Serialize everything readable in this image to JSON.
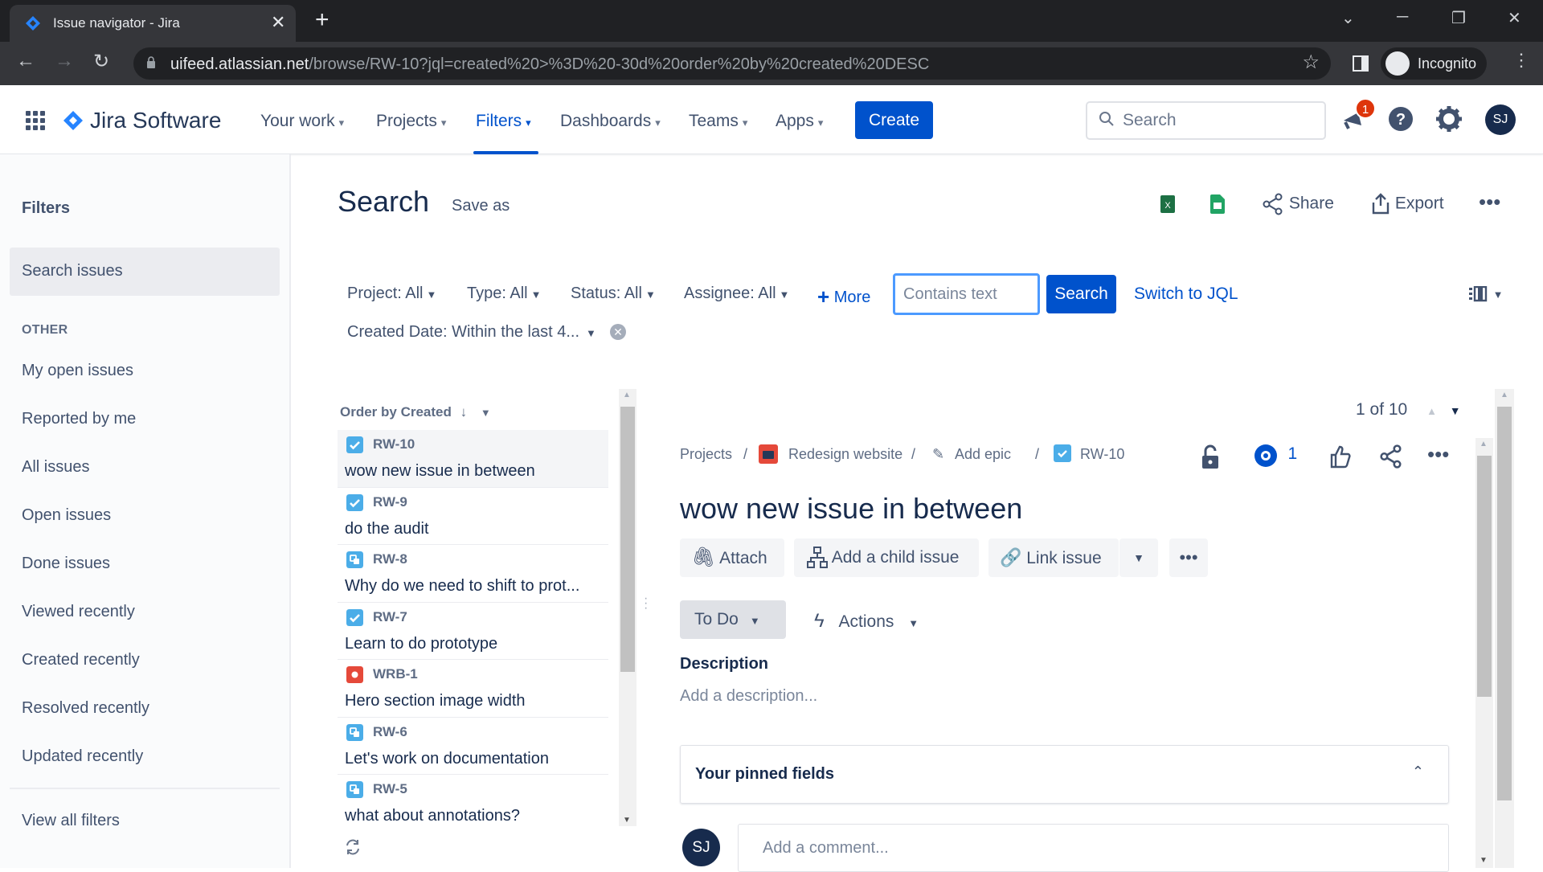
{
  "browser": {
    "tab_title": "Issue navigator - Jira",
    "url_host": "uifeed.atlassian.net",
    "url_path": "/browse/RW-10?jql=created%20>%3D%20-30d%20order%20by%20created%20DESC",
    "profile_label": "Incognito"
  },
  "header": {
    "product_name": "Jira Software",
    "nav": [
      {
        "label": "Your work"
      },
      {
        "label": "Projects"
      },
      {
        "label": "Filters"
      },
      {
        "label": "Dashboards"
      },
      {
        "label": "Teams"
      },
      {
        "label": "Apps"
      }
    ],
    "create_label": "Create",
    "search_placeholder": "Search",
    "notification_count": "1",
    "user_initials": "SJ",
    "accent": "#0052cc"
  },
  "sidebar": {
    "title": "Filters",
    "selected": "Search issues",
    "section_label": "OTHER",
    "items": [
      {
        "label": "My open issues"
      },
      {
        "label": "Reported by me"
      },
      {
        "label": "All issues"
      },
      {
        "label": "Open issues"
      },
      {
        "label": "Done issues"
      },
      {
        "label": "Viewed recently"
      },
      {
        "label": "Created recently"
      },
      {
        "label": "Resolved recently"
      },
      {
        "label": "Updated recently"
      }
    ],
    "footer": "View all filters"
  },
  "main": {
    "title": "Search",
    "save_as": "Save as",
    "toolbar": {
      "share": "Share",
      "export": "Export"
    },
    "filters": {
      "project": "Project: All",
      "type": "Type: All",
      "status": "Status: All",
      "assignee": "Assignee: All",
      "more": "More",
      "text_placeholder": "Contains text",
      "search_button": "Search",
      "switch_jql": "Switch to JQL",
      "created_date": "Created Date: Within the last 4..."
    },
    "order_by": "Order by Created",
    "issues": [
      {
        "key": "RW-10",
        "summary": "wow new issue in between",
        "type": "task"
      },
      {
        "key": "RW-9",
        "summary": "do the audit",
        "type": "task"
      },
      {
        "key": "RW-8",
        "summary": "Why do we need to shift to prot...",
        "type": "subtask"
      },
      {
        "key": "RW-7",
        "summary": "Learn to do prototype",
        "type": "task"
      },
      {
        "key": "WRB-1",
        "summary": "Hero section image width",
        "type": "bug"
      },
      {
        "key": "RW-6",
        "summary": "Let's work on documentation",
        "type": "subtask"
      },
      {
        "key": "RW-5",
        "summary": "what about annotations?",
        "type": "subtask"
      }
    ]
  },
  "detail": {
    "pager": "1 of 10",
    "breadcrumbs": {
      "projects": "Projects",
      "project": "Redesign website",
      "epic": "Add epic",
      "key": "RW-10"
    },
    "watchers": "1",
    "title": "wow new issue in between",
    "buttons": {
      "attach": "Attach",
      "child": "Add a child issue",
      "link": "Link issue"
    },
    "status": "To Do",
    "actions": "Actions",
    "description_label": "Description",
    "description_placeholder": "Add a description...",
    "pinned_fields": "Your pinned fields",
    "comment_placeholder": "Add a comment...",
    "commenter_initials": "SJ"
  }
}
